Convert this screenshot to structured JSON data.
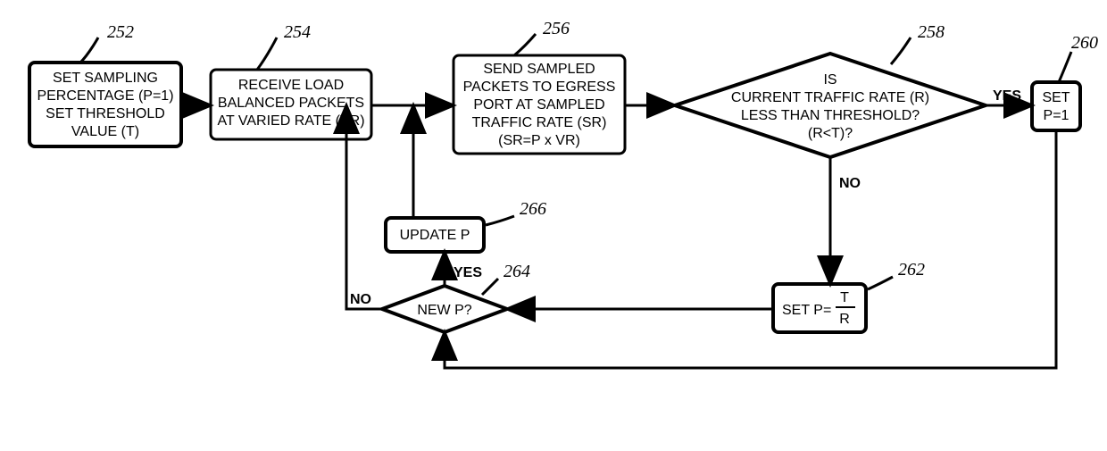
{
  "refs": {
    "b252": "252",
    "b254": "254",
    "b256": "256",
    "b258": "258",
    "b260": "260",
    "b262": "262",
    "b264": "264",
    "b266": "266"
  },
  "boxes": {
    "b252": {
      "l1": "SET SAMPLING",
      "l2": "PERCENTAGE (P=1)",
      "l3": "SET THRESHOLD",
      "l4": "VALUE (T)"
    },
    "b254": {
      "l1": "RECEIVE LOAD",
      "l2": "BALANCED PACKETS",
      "l3": "AT VARIED RATE (VR)"
    },
    "b256": {
      "l1": "SEND SAMPLED",
      "l2": "PACKETS TO EGRESS",
      "l3": "PORT AT SAMPLED",
      "l4": "TRAFFIC RATE (SR)",
      "l5": "(SR=P x VR)"
    },
    "b258": {
      "l1": "IS",
      "l2": "CURRENT TRAFFIC RATE (R)",
      "l3": "LESS THAN THRESHOLD?",
      "l4": "(R<T)?"
    },
    "b260": {
      "l1": "SET",
      "l2": "P=1"
    },
    "b262": {
      "pre": "SET P=",
      "num": "T",
      "den": "R"
    },
    "b264": {
      "l1": "NEW P?"
    },
    "b266": {
      "l1": "UPDATE P"
    }
  },
  "labels": {
    "yes": "YES",
    "no": "NO"
  }
}
